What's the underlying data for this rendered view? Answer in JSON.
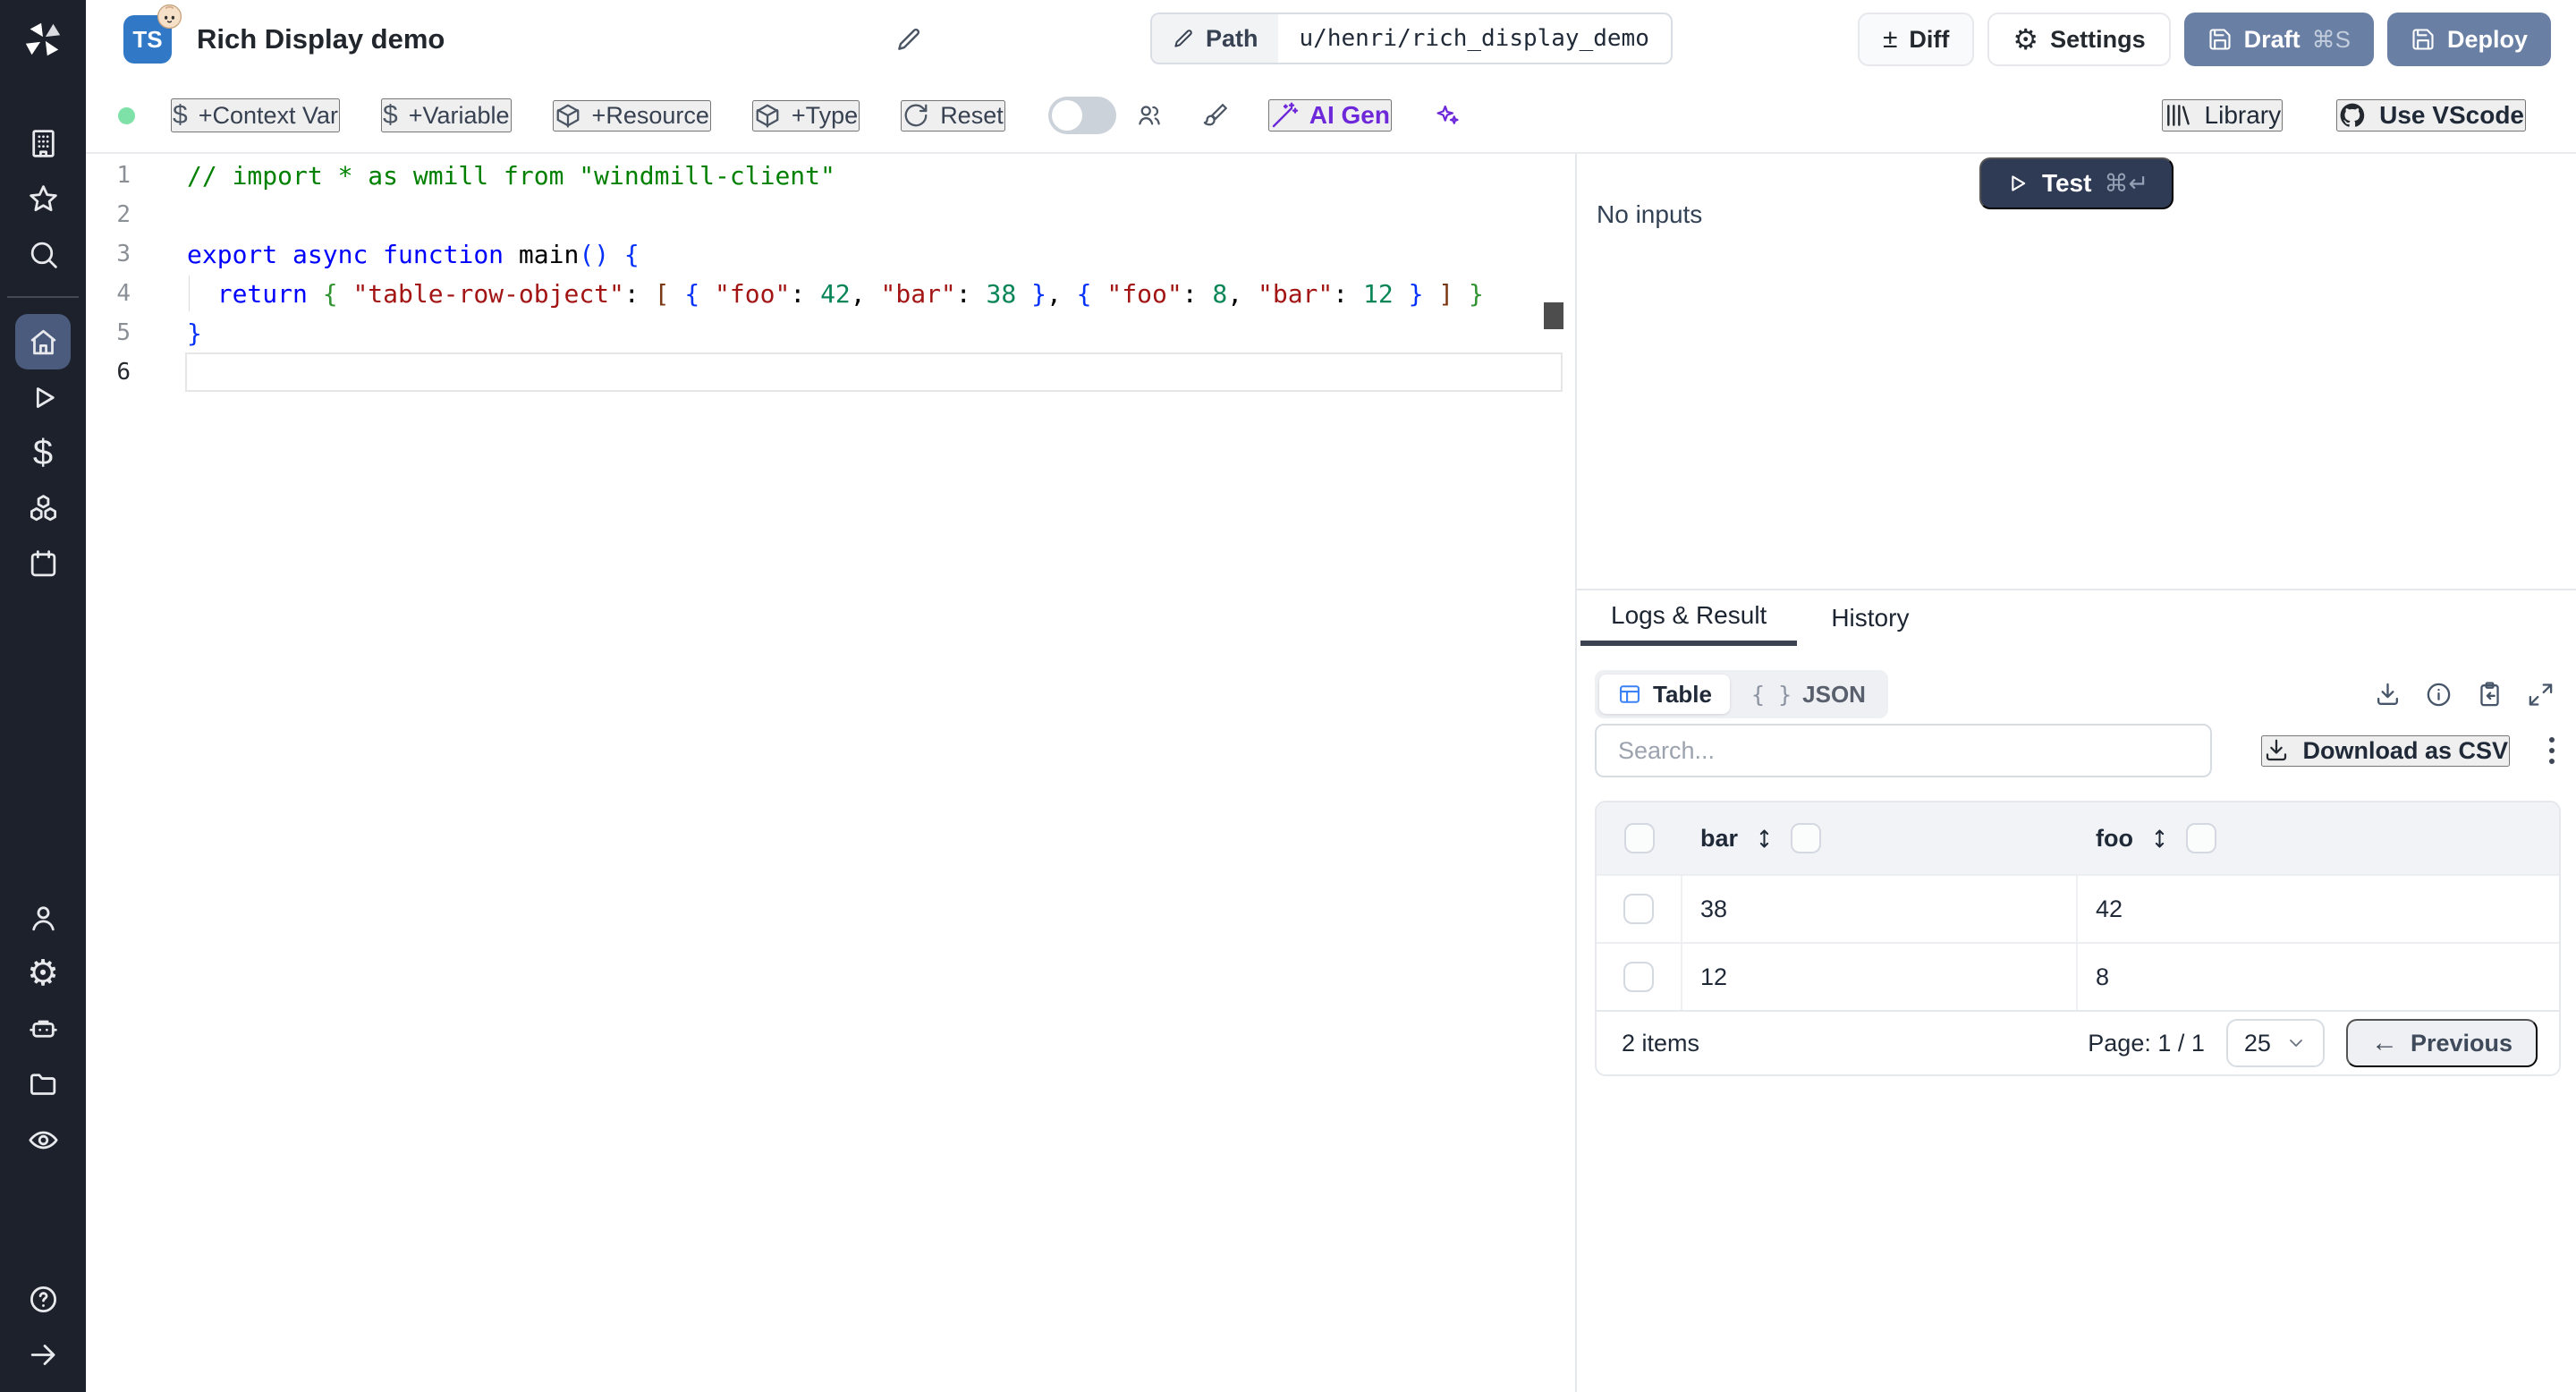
{
  "topbar": {
    "title": "Rich Display demo",
    "path_label": "Path",
    "path_value": "u/henri/rich_display_demo",
    "diff": "Diff",
    "settings": "Settings",
    "draft": "Draft",
    "draft_shortcut": "⌘S",
    "deploy": "Deploy"
  },
  "toolbar": {
    "context_var": "+Context Var",
    "variable": "+Variable",
    "resource": "+Resource",
    "type": "+Type",
    "reset": "Reset",
    "ai_gen": "AI Gen",
    "library": "Library",
    "use_vscode": "Use VScode"
  },
  "sidebar": {
    "active": "home",
    "groups": [
      [
        "building",
        "star",
        "search"
      ],
      [
        "home",
        "play",
        "dollar",
        "cubes",
        "calendar"
      ],
      [
        "user",
        "gear",
        "robot",
        "folder",
        "eye"
      ],
      [
        "help",
        "arrow-right"
      ]
    ]
  },
  "editor": {
    "language_badge": "TS",
    "lines": [
      {
        "num": "1",
        "tokens": [
          [
            "// import * as wmill from \"windmill-client\"",
            "cmt"
          ]
        ]
      },
      {
        "num": "2",
        "tokens": []
      },
      {
        "num": "3",
        "tokens": [
          [
            "export",
            "kw"
          ],
          [
            " ",
            ""
          ],
          [
            "async",
            "kw"
          ],
          [
            " ",
            ""
          ],
          [
            "function",
            "kw"
          ],
          [
            " ",
            ""
          ],
          [
            "main",
            ""
          ],
          [
            "(",
            "b1"
          ],
          [
            ")",
            "b1"
          ],
          [
            " ",
            ""
          ],
          [
            "{",
            "b1"
          ]
        ]
      },
      {
        "num": "4",
        "guide": true,
        "tokens": [
          [
            "  ",
            ""
          ],
          [
            "return",
            "kw"
          ],
          [
            " ",
            ""
          ],
          [
            "{",
            "b2"
          ],
          [
            " ",
            ""
          ],
          [
            "\"table-row-object\"",
            "str"
          ],
          [
            ":",
            ""
          ],
          [
            " ",
            ""
          ],
          [
            "[",
            "b3"
          ],
          [
            " ",
            ""
          ],
          [
            "{",
            "b1"
          ],
          [
            " ",
            ""
          ],
          [
            "\"foo\"",
            "str"
          ],
          [
            ":",
            ""
          ],
          [
            " ",
            ""
          ],
          [
            "42",
            "num"
          ],
          [
            ",",
            ""
          ],
          [
            " ",
            ""
          ],
          [
            "\"bar\"",
            "str"
          ],
          [
            ":",
            ""
          ],
          [
            " ",
            ""
          ],
          [
            "38",
            "num"
          ],
          [
            " ",
            ""
          ],
          [
            "}",
            "b1"
          ],
          [
            ",",
            ""
          ],
          [
            " ",
            ""
          ],
          [
            "{",
            "b1"
          ],
          [
            " ",
            ""
          ],
          [
            "\"foo\"",
            "str"
          ],
          [
            ":",
            ""
          ],
          [
            " ",
            ""
          ],
          [
            "8",
            "num"
          ],
          [
            ",",
            ""
          ],
          [
            " ",
            ""
          ],
          [
            "\"bar\"",
            "str"
          ],
          [
            ":",
            ""
          ],
          [
            " ",
            ""
          ],
          [
            "12",
            "num"
          ],
          [
            " ",
            ""
          ],
          [
            "}",
            "b1"
          ],
          [
            " ",
            ""
          ],
          [
            "]",
            "b3"
          ],
          [
            " ",
            ""
          ],
          [
            "}",
            "b2"
          ]
        ]
      },
      {
        "num": "5",
        "tokens": [
          [
            "}",
            "b1"
          ]
        ]
      },
      {
        "num": "6",
        "current": true,
        "tokens": []
      }
    ]
  },
  "run": {
    "test": "Test",
    "shortcut": "⌘↵",
    "no_inputs": "No inputs"
  },
  "result": {
    "tab_logs": "Logs & Result",
    "tab_history": "History",
    "view_table": "Table",
    "view_json": "JSON",
    "search_placeholder": "Search...",
    "download_csv": "Download as CSV",
    "table": {
      "columns": [
        "bar",
        "foo"
      ],
      "rows": [
        [
          "38",
          "42"
        ],
        [
          "12",
          "8"
        ]
      ],
      "footer": {
        "items": "2 items",
        "page": "Page: 1 / 1",
        "page_size": "25",
        "previous": "Previous"
      }
    }
  },
  "colors": {
    "accent_blue": "#3b82f6",
    "action_slate": "#697fa4",
    "dark_navy": "#2f3a55",
    "ai_purple": "#6d28d9",
    "status_green": "#7ee2a8",
    "ts_blue": "#3178c6"
  }
}
